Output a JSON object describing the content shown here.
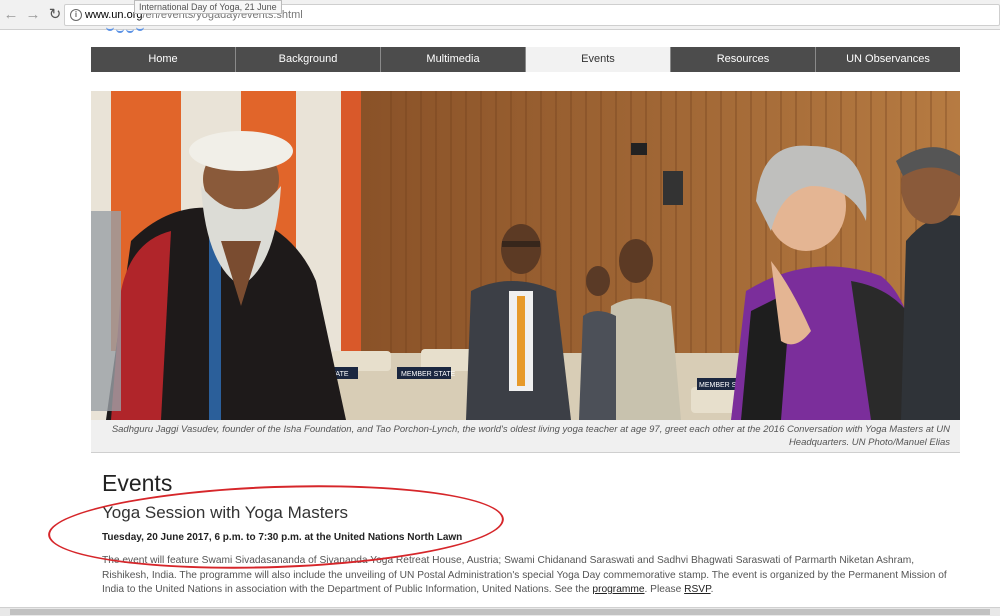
{
  "browser": {
    "url_domain": "www.un.org",
    "url_path": "/en/events/yogaday/events.shtml",
    "tooltip": "International Day of Yoga, 21 June"
  },
  "nav": {
    "tabs": [
      {
        "label": "Home"
      },
      {
        "label": "Background"
      },
      {
        "label": "Multimedia"
      },
      {
        "label": "Events",
        "active": true
      },
      {
        "label": "Resources"
      },
      {
        "label": "UN Observances"
      }
    ]
  },
  "hero": {
    "caption": "Sadhguru Jaggi Vasudev, founder of the Isha Foundation, and Tao Porchon-Lynch, the world's oldest living yoga teacher at age 97, greet each other at the 2016 Conversation with Yoga Masters at UN Headquarters. UN Photo/Manuel Elias",
    "placards": [
      "STATE",
      "MEMBER STATE",
      "MEMBER ST"
    ]
  },
  "content": {
    "heading": "Events",
    "event_title": "Yoga Session with Yoga Masters",
    "event_date": "Tuesday, 20 June 2017, 6 p.m. to 7:30 p.m. at the United Nations North Lawn",
    "desc_part1": "The event will feature Swami Sivadasananda of Sivananda Yoga Retreat House, Austria;  Swami Chidanand Saraswati and Sadhvi Bhagwati Saraswati of Parmarth Niketan Ashram, Rishikesh, India.  The programme will also include the unveiling of UN Postal Administration's special Yoga Day commemorative stamp.  The event is organized by the Permanent Mission of India to the United Nations in association with the Department of Public Information, United Nations. See the ",
    "programme_link": "programme",
    "desc_part2": ". Please ",
    "rsvp_link": "RSVP",
    "desc_part3": "."
  },
  "colors": {
    "nav_bg": "#4c4c4c",
    "nav_active_bg": "#f2f2f2",
    "annotation": "#d6262a"
  }
}
